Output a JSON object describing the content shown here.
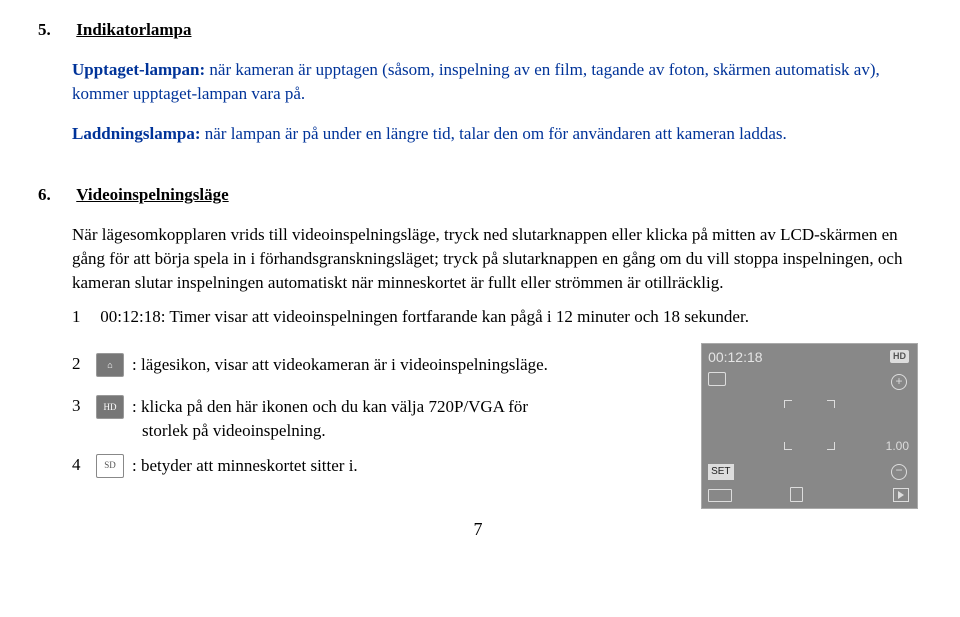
{
  "sec5": {
    "num": "5.",
    "title": "Indikatorlampa",
    "p1_label": "Upptaget-lampan:",
    "p1_text": " när kameran är upptagen (såsom, inspelning av en film, tagande av foton, skärmen automatisk av), kommer upptaget-lampan vara på.",
    "p2_label": "Laddningslampa:",
    "p2_text": " när lampan är på under en längre tid, talar den om för användaren att kameran laddas."
  },
  "sec6": {
    "num": "6.",
    "title": "Videoinspelningsläge",
    "body": "När lägesomkopplaren vrids till videoinspelningsläge, tryck ned slutarknappen eller klicka på mitten av LCD-skärmen en gång för att börja spela in i förhandsgranskningsläget; tryck på slutarknappen en gång om du vill stoppa inspelningen, och kameran slutar inspelningen automatiskt när minneskortet är fullt eller strömmen är otillräcklig.",
    "item1": "00:12:18: Timer visar att videoinspelningen fortfarande kan pågå i 12 minuter och 18 sekunder.",
    "item2": ": lägesikon, visar att videokameran är i videoinspelningsläge.",
    "item3a": ": klicka på den här ikonen och du kan välja 720P/VGA för",
    "item3b": "storlek på videoinspelning.",
    "item4": ": betyder att minneskortet sitter i.",
    "nums": {
      "n1": "1",
      "n2": "2",
      "n3": "3",
      "n4": "4"
    },
    "icons": {
      "hd": "HD",
      "cam": "⌂",
      "sd": "SD"
    }
  },
  "screen": {
    "timer": "00:12:18",
    "hd": "HD",
    "zoom": "1.00",
    "set": "SET",
    "plus": "+",
    "minus": "−"
  },
  "pagenum": "7"
}
